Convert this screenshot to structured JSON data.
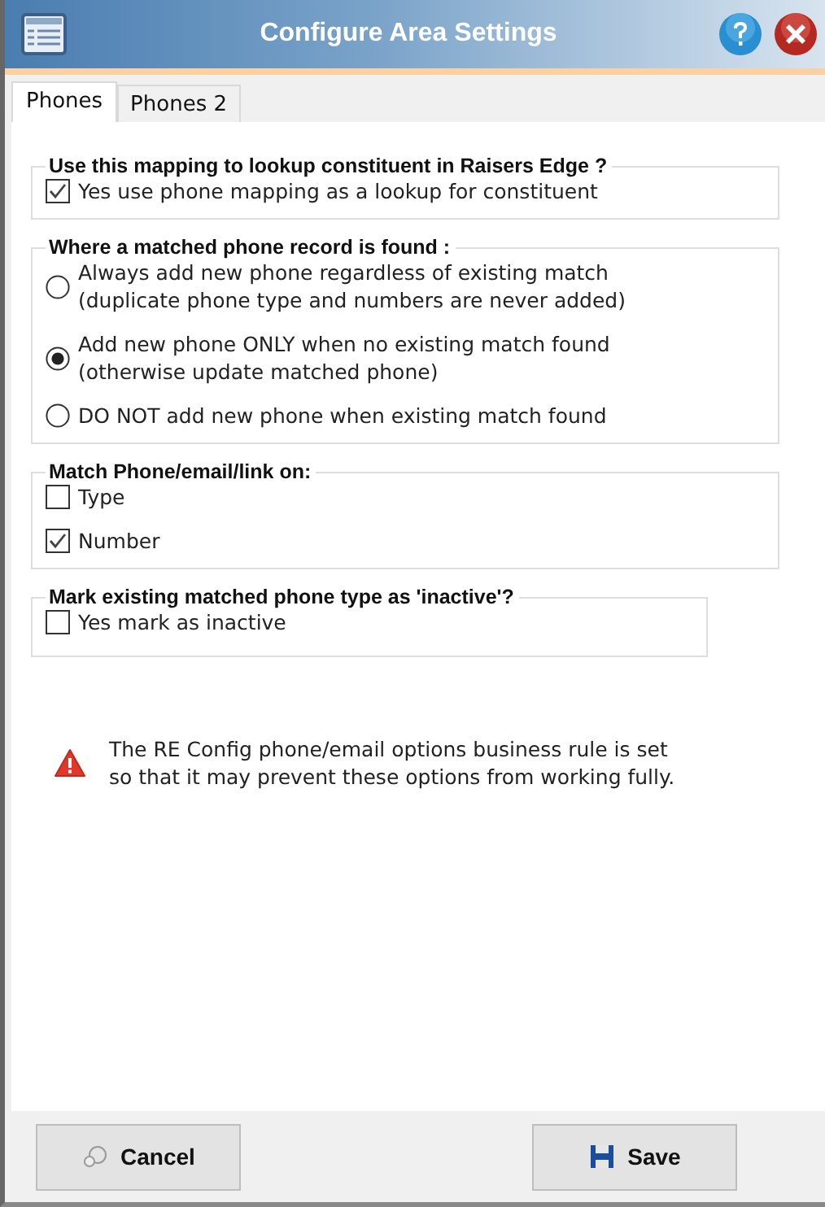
{
  "window": {
    "title": "Configure Area Settings"
  },
  "tabs": [
    {
      "label": "Phones",
      "selected": true
    },
    {
      "label": "Phones 2",
      "selected": false
    }
  ],
  "groups": [
    {
      "title": "Use this mapping to lookup constituent in Raisers Edge ?",
      "kind": "checkbox",
      "options": [
        {
          "label": "Yes use phone mapping as a lookup for constituent",
          "checked": true
        }
      ]
    },
    {
      "title": "Where a matched phone record is found :",
      "kind": "radio",
      "options": [
        {
          "label": "Always add new phone regardless of existing match\n(duplicate phone type and numbers are never added)",
          "selected": false
        },
        {
          "label": "Add new phone ONLY when no existing match found\n(otherwise update matched phone)",
          "selected": true
        },
        {
          "label": "DO NOT add new phone when existing match found",
          "selected": false
        }
      ]
    },
    {
      "title": "Match Phone/email/link on:",
      "kind": "checkbox",
      "options": [
        {
          "label": "Type",
          "checked": false
        },
        {
          "label": "Number",
          "checked": true
        }
      ]
    },
    {
      "title": "Mark existing matched phone type as 'inactive'?",
      "kind": "checkbox",
      "options": [
        {
          "label": "Yes mark as inactive",
          "checked": false
        }
      ]
    }
  ],
  "warning": "The RE Config phone/email options business rule is set\nso that it may prevent these options from working fully.",
  "buttons": [
    {
      "label": "Cancel",
      "kind": "cancel"
    },
    {
      "label": "Save",
      "kind": "save"
    }
  ]
}
